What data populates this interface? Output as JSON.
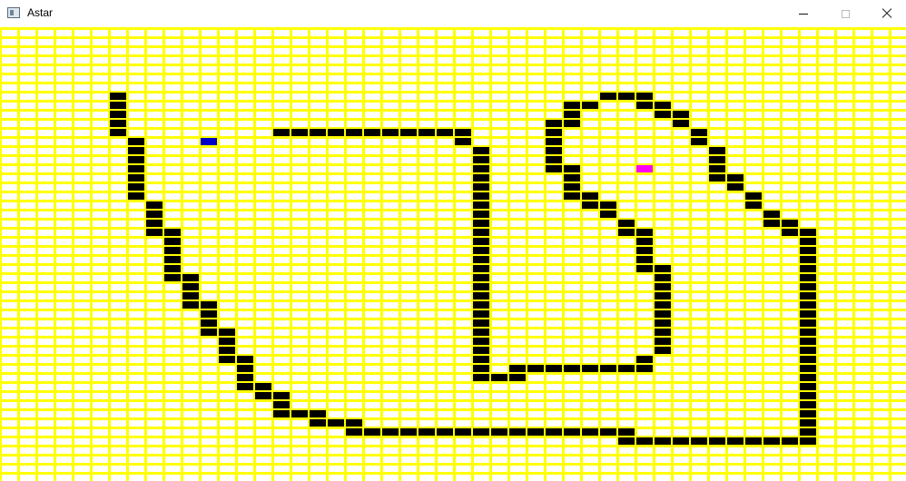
{
  "window": {
    "title": "Astar",
    "icon": "app-window-icon",
    "controls": [
      "minimize-icon",
      "maximize-icon",
      "close-icon"
    ]
  },
  "colors": {
    "grid_line": "#ffff00",
    "background": "#ffffff",
    "wall": "#000000",
    "start": "#0000cc",
    "goal": "#ff00ff"
  },
  "grid": {
    "cols": 50,
    "rows": 50,
    "walls": [
      [
        6,
        7
      ],
      [
        6,
        8
      ],
      [
        6,
        9
      ],
      [
        6,
        10
      ],
      [
        6,
        11
      ],
      [
        7,
        12
      ],
      [
        7,
        13
      ],
      [
        7,
        14
      ],
      [
        7,
        15
      ],
      [
        7,
        16
      ],
      [
        7,
        17
      ],
      [
        7,
        18
      ],
      [
        8,
        19
      ],
      [
        8,
        20
      ],
      [
        8,
        21
      ],
      [
        8,
        22
      ],
      [
        9,
        22
      ],
      [
        9,
        23
      ],
      [
        9,
        24
      ],
      [
        9,
        25
      ],
      [
        9,
        26
      ],
      [
        9,
        27
      ],
      [
        10,
        27
      ],
      [
        10,
        28
      ],
      [
        10,
        29
      ],
      [
        10,
        30
      ],
      [
        11,
        30
      ],
      [
        11,
        31
      ],
      [
        11,
        32
      ],
      [
        11,
        33
      ],
      [
        12,
        33
      ],
      [
        12,
        34
      ],
      [
        12,
        35
      ],
      [
        12,
        36
      ],
      [
        13,
        36
      ],
      [
        13,
        37
      ],
      [
        13,
        38
      ],
      [
        13,
        39
      ],
      [
        14,
        39
      ],
      [
        14,
        40
      ],
      [
        15,
        40
      ],
      [
        15,
        41
      ],
      [
        15,
        42
      ],
      [
        16,
        42
      ],
      [
        17,
        42
      ],
      [
        17,
        43
      ],
      [
        18,
        43
      ],
      [
        19,
        43
      ],
      [
        19,
        44
      ],
      [
        20,
        44
      ],
      [
        21,
        44
      ],
      [
        22,
        44
      ],
      [
        23,
        44
      ],
      [
        24,
        44
      ],
      [
        25,
        44
      ],
      [
        26,
        44
      ],
      [
        27,
        44
      ],
      [
        28,
        44
      ],
      [
        29,
        44
      ],
      [
        30,
        44
      ],
      [
        31,
        44
      ],
      [
        32,
        44
      ],
      [
        33,
        44
      ],
      [
        34,
        44
      ],
      [
        34,
        45
      ],
      [
        35,
        45
      ],
      [
        36,
        45
      ],
      [
        37,
        45
      ],
      [
        38,
        45
      ],
      [
        39,
        45
      ],
      [
        40,
        45
      ],
      [
        41,
        45
      ],
      [
        42,
        45
      ],
      [
        43,
        45
      ],
      [
        44,
        45
      ],
      [
        44,
        22
      ],
      [
        44,
        23
      ],
      [
        44,
        24
      ],
      [
        44,
        25
      ],
      [
        44,
        26
      ],
      [
        44,
        27
      ],
      [
        44,
        28
      ],
      [
        44,
        29
      ],
      [
        44,
        30
      ],
      [
        44,
        31
      ],
      [
        44,
        32
      ],
      [
        44,
        33
      ],
      [
        44,
        34
      ],
      [
        44,
        35
      ],
      [
        44,
        36
      ],
      [
        44,
        37
      ],
      [
        44,
        38
      ],
      [
        44,
        39
      ],
      [
        44,
        40
      ],
      [
        44,
        41
      ],
      [
        44,
        42
      ],
      [
        44,
        43
      ],
      [
        44,
        44
      ],
      [
        15,
        11
      ],
      [
        16,
        11
      ],
      [
        17,
        11
      ],
      [
        18,
        11
      ],
      [
        19,
        11
      ],
      [
        20,
        11
      ],
      [
        21,
        11
      ],
      [
        22,
        11
      ],
      [
        23,
        11
      ],
      [
        24,
        11
      ],
      [
        25,
        11
      ],
      [
        25,
        12
      ],
      [
        26,
        13
      ],
      [
        26,
        14
      ],
      [
        26,
        15
      ],
      [
        26,
        16
      ],
      [
        26,
        17
      ],
      [
        26,
        18
      ],
      [
        26,
        19
      ],
      [
        26,
        20
      ],
      [
        26,
        21
      ],
      [
        26,
        22
      ],
      [
        26,
        23
      ],
      [
        26,
        24
      ],
      [
        26,
        25
      ],
      [
        26,
        26
      ],
      [
        26,
        27
      ],
      [
        26,
        28
      ],
      [
        26,
        29
      ],
      [
        26,
        30
      ],
      [
        26,
        31
      ],
      [
        26,
        32
      ],
      [
        26,
        33
      ],
      [
        26,
        34
      ],
      [
        26,
        35
      ],
      [
        26,
        36
      ],
      [
        26,
        37
      ],
      [
        26,
        38
      ],
      [
        27,
        38
      ],
      [
        28,
        38
      ],
      [
        28,
        37
      ],
      [
        29,
        37
      ],
      [
        30,
        37
      ],
      [
        31,
        37
      ],
      [
        32,
        37
      ],
      [
        33,
        37
      ],
      [
        34,
        37
      ],
      [
        35,
        36
      ],
      [
        35,
        37
      ],
      [
        36,
        35
      ],
      [
        36,
        34
      ],
      [
        36,
        33
      ],
      [
        36,
        32
      ],
      [
        36,
        31
      ],
      [
        36,
        30
      ],
      [
        36,
        29
      ],
      [
        36,
        28
      ],
      [
        36,
        27
      ],
      [
        36,
        26
      ],
      [
        35,
        26
      ],
      [
        35,
        25
      ],
      [
        35,
        24
      ],
      [
        35,
        23
      ],
      [
        35,
        22
      ],
      [
        34,
        22
      ],
      [
        34,
        21
      ],
      [
        33,
        20
      ],
      [
        33,
        19
      ],
      [
        32,
        19
      ],
      [
        32,
        18
      ],
      [
        31,
        18
      ],
      [
        31,
        17
      ],
      [
        31,
        16
      ],
      [
        31,
        15
      ],
      [
        30,
        15
      ],
      [
        30,
        14
      ],
      [
        30,
        13
      ],
      [
        30,
        12
      ],
      [
        30,
        11
      ],
      [
        30,
        10
      ],
      [
        31,
        10
      ],
      [
        31,
        9
      ],
      [
        31,
        8
      ],
      [
        32,
        8
      ],
      [
        33,
        7
      ],
      [
        34,
        7
      ],
      [
        35,
        7
      ],
      [
        35,
        8
      ],
      [
        36,
        8
      ],
      [
        36,
        9
      ],
      [
        37,
        9
      ],
      [
        37,
        10
      ],
      [
        38,
        11
      ],
      [
        38,
        12
      ],
      [
        39,
        13
      ],
      [
        39,
        14
      ],
      [
        39,
        15
      ],
      [
        39,
        16
      ],
      [
        40,
        16
      ],
      [
        40,
        17
      ],
      [
        41,
        18
      ],
      [
        41,
        19
      ],
      [
        42,
        20
      ],
      [
        42,
        21
      ],
      [
        43,
        21
      ],
      [
        43,
        22
      ]
    ],
    "start": [
      11,
      12
    ],
    "goal": [
      35,
      15
    ]
  }
}
